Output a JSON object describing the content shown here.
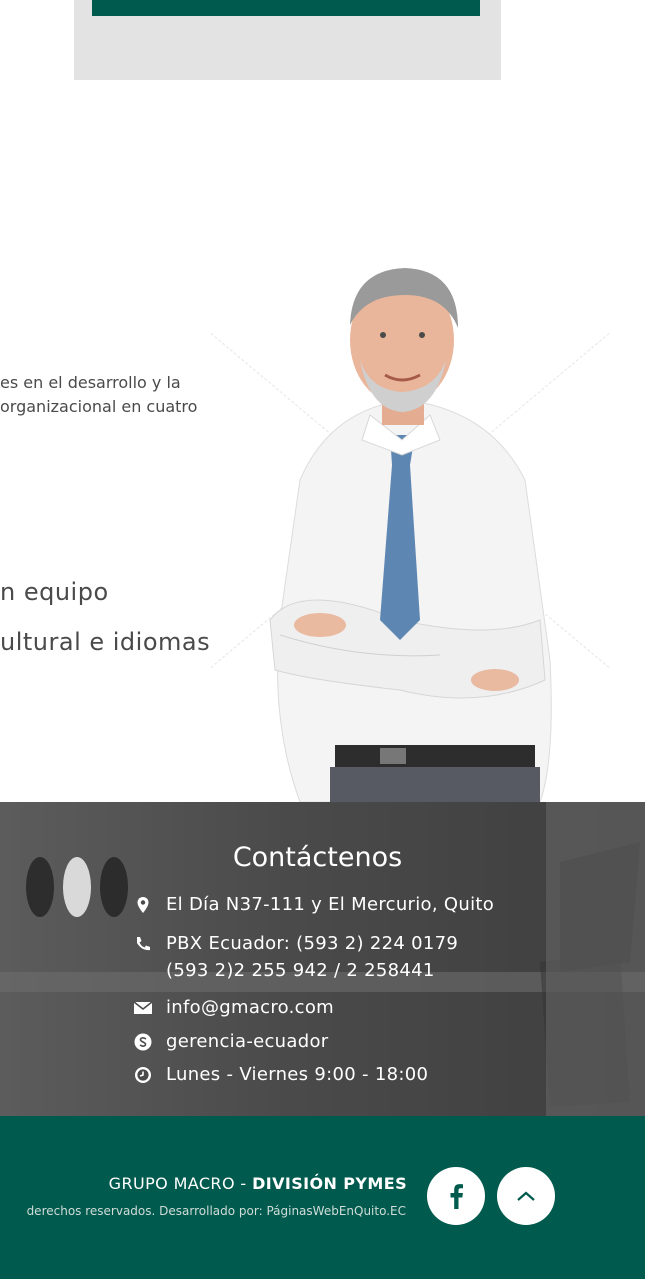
{
  "hero": {
    "para_line1": "es en el desarrollo y la",
    "para_line2": "organizacional en cuatro",
    "feature1": "n equipo",
    "feature2": "ultural e idiomas"
  },
  "contact": {
    "title": "Contáctenos",
    "address": "El Día N37-111 y El Mercurio, Quito",
    "phone_line1": "PBX Ecuador: (593 2) 224 0179",
    "phone_line2": "(593 2)2 255 942 / 2 258441",
    "email": "info@gmacro.com",
    "skype": "gerencia-ecuador",
    "hours": "Lunes - Viernes 9:00 - 18:00",
    "icons": [
      "map-marker-icon",
      "phone-icon",
      "envelope-icon",
      "skype-icon",
      "clock-icon"
    ]
  },
  "footer": {
    "brand_prefix": "GRUPO MACRO - ",
    "brand_strong": "DIVISIÓN PYMES",
    "copyright": "derechos reservados. Desarrollado por: PáginasWebEnQuito.EC",
    "accent": "#005a4d"
  }
}
